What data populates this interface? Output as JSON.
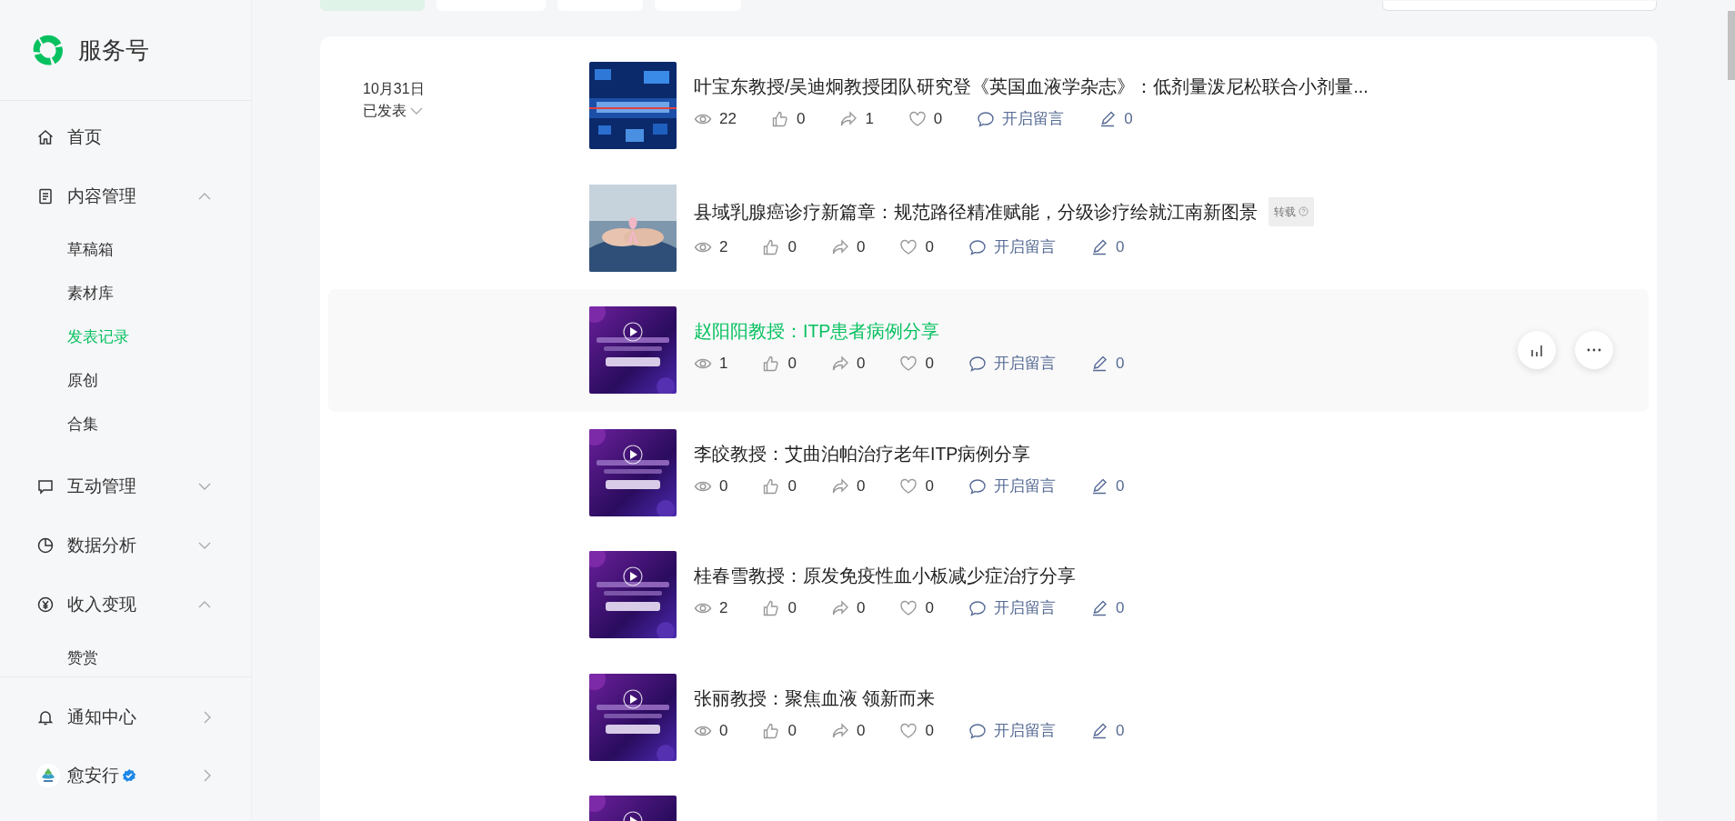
{
  "sidebar": {
    "brand": "服务号",
    "menu": [
      {
        "label": "首页"
      },
      {
        "label": "内容管理",
        "expanded": true,
        "children": [
          {
            "label": "草稿箱",
            "selected": false
          },
          {
            "label": "素材库",
            "selected": false
          },
          {
            "label": "发表记录",
            "selected": true
          },
          {
            "label": "原创",
            "selected": false
          },
          {
            "label": "合集",
            "selected": false
          }
        ]
      },
      {
        "label": "互动管理",
        "expanded": false
      },
      {
        "label": "数据分析",
        "expanded": false
      },
      {
        "label": "收入变现",
        "expanded": true,
        "children": [
          {
            "label": "赞赏",
            "selected": false
          }
        ]
      }
    ],
    "footer": [
      {
        "label": "通知中心",
        "kind": "notice"
      },
      {
        "label": "愈安行",
        "kind": "account",
        "verified": true
      }
    ]
  },
  "tabs": [
    {
      "selected": true
    },
    {
      "selected": false
    },
    {
      "selected": false
    },
    {
      "selected": false
    }
  ],
  "groups": [
    {
      "date": "10月31日",
      "status": "已发表",
      "posts": [
        {
          "kind": "news",
          "title": "叶宝东教授/吴迪炯教授团队研究登《英国血液学杂志》：低剂量泼尼松联合小剂量...",
          "views": "22",
          "likes": "0",
          "shares": "1",
          "favorites": "0",
          "comment": "开启留言",
          "edits": "0",
          "hovered": false
        },
        {
          "title": "县域乳腺癌诊疗新篇章：规范路径精准赋能，分级诊疗绘就江南新图景",
          "tag": "转载",
          "views": "2",
          "likes": "0",
          "shares": "0",
          "favorites": "0",
          "comment": "开启留言",
          "edits": "0",
          "hovered": false
        },
        {
          "kind": "video",
          "title": "赵阳阳教授：ITP患者病例分享",
          "views": "1",
          "likes": "0",
          "shares": "0",
          "favorites": "0",
          "comment": "开启留言",
          "edits": "0",
          "hovered": true
        },
        {
          "kind": "video",
          "title": "李皎教授：艾曲泊帕治疗老年ITP病例分享",
          "views": "0",
          "likes": "0",
          "shares": "0",
          "favorites": "0",
          "comment": "开启留言",
          "edits": "0",
          "hovered": false
        },
        {
          "kind": "video",
          "title": "桂春雪教授：原发免疫性血小板减少症治疗分享",
          "views": "2",
          "likes": "0",
          "shares": "0",
          "favorites": "0",
          "comment": "开启留言",
          "edits": "0",
          "hovered": false
        },
        {
          "kind": "video",
          "title": "张丽教授：聚焦血液 领新而来",
          "views": "0",
          "likes": "0",
          "shares": "0",
          "favorites": "0",
          "comment": "开启留言",
          "edits": "0",
          "hovered": false
        },
        {
          "kind": "video",
          "hovered": false
        }
      ]
    }
  ]
}
